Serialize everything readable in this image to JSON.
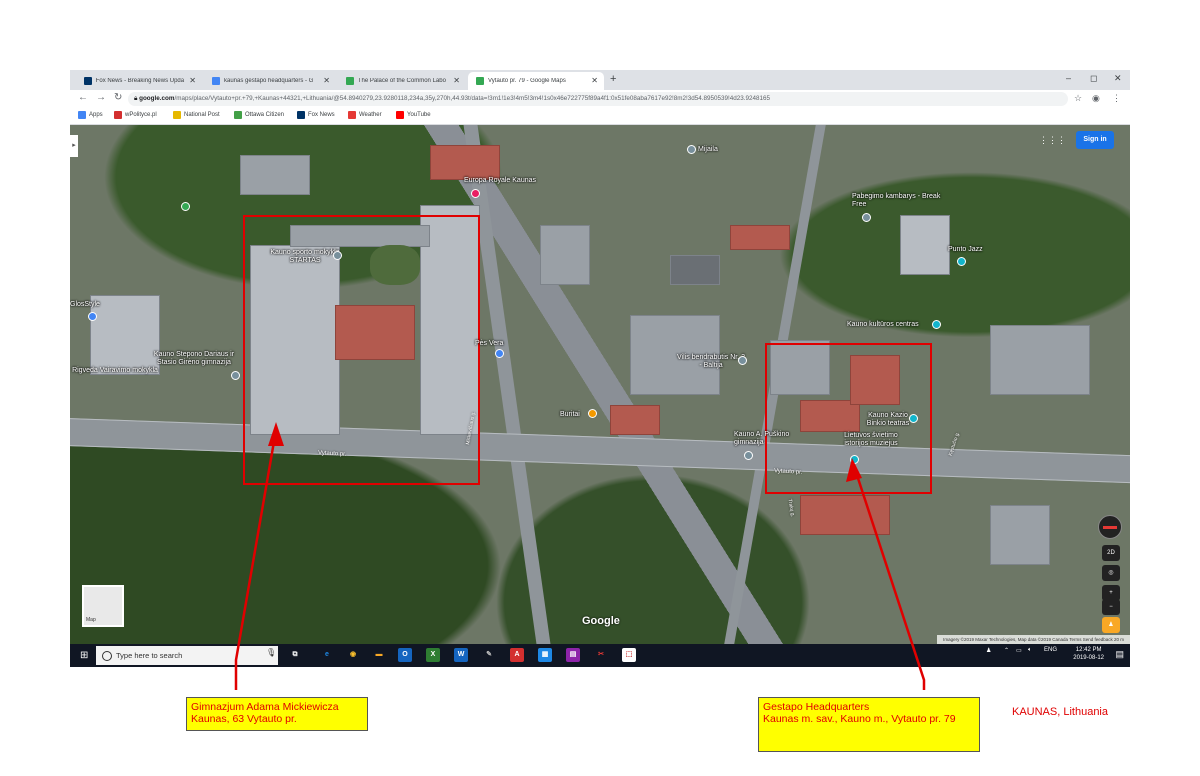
{
  "browser": {
    "tabs": [
      {
        "title": "Fox News - Breaking News Upda",
        "favicon_color": "#003366",
        "active": false
      },
      {
        "title": "kaunas gestapo headquarters - G",
        "favicon_color": "#4285f4",
        "active": false
      },
      {
        "title": "The Palace of the Common Labo",
        "favicon_color": "#34a853",
        "active": false
      },
      {
        "title": "Vytauto pr. 79 - Google Maps",
        "favicon_color": "#34a853",
        "active": true
      }
    ],
    "new_tab": "+",
    "window_controls": {
      "minimize": "–",
      "maximize": "◻",
      "close": "✕"
    },
    "url_host": "google.com",
    "url_path": "/maps/place/Vytauto+pr.+79,+Kaunas+44321,+Lithuania/@54.8940279,23.9280118,234a,35y,270h,44.93t/data=!3m1!1e3!4m5!3m4!1s0x46e722775f89a4f1:0x51fe08aba7617e92!8m2!3d54.8950539!4d23.9248165",
    "bookmarks": [
      {
        "label": "Apps",
        "color": "#4285f4"
      },
      {
        "label": "wPolityce.pl",
        "color": "#d32f2f"
      },
      {
        "label": "National Post",
        "color": "#e6b800"
      },
      {
        "label": "Ottawa Citizen",
        "color": "#43a047"
      },
      {
        "label": "Fox News",
        "color": "#003366"
      },
      {
        "label": "Weather",
        "color": "#e53935"
      },
      {
        "label": "YouTube",
        "color": "#ff0000"
      }
    ]
  },
  "map": {
    "sign_in": "Sign in",
    "places": [
      "Mijaila",
      "Europa Royale Kaunas",
      "Pabegimo kambarys - Break Free",
      "Punto Jazz",
      "Kauno sporto mokykla STARTAS",
      "GlosStyle",
      "Kauno kultūros centras",
      "Pės Vera",
      "Vilis bendrabutis Nr. 2 - Baltija",
      "Kauno Stepono Dariaus ir Stasio Girėno gimnazija",
      "Rigveda Vairavimo mokykla",
      "Buritai",
      "Kauno Kazio Binkio teatras",
      "Kauno A. Puškino gimnazija",
      "Lietuvos švietimo istorijos muziejus"
    ],
    "streets": [
      "Vytauto pr.",
      "Vytauto pr.",
      "Mickevičiaus g.",
      "Trakų g.",
      "Kęstučio g."
    ],
    "controls": {
      "tilt": "2D",
      "zoom_in": "+",
      "zoom_out": "−"
    },
    "minimap_label": "Map",
    "watermark": "Google",
    "attribution": "Imagery ©2019 Maxar Technologies, Map data ©2019   Canada   Terms   Send feedback   20 m"
  },
  "taskbar": {
    "search_placeholder": "Type here to search",
    "apps": [
      {
        "glyph": "e",
        "color": "#1e88e5"
      },
      {
        "glyph": "◉",
        "color": "#fbc02d"
      },
      {
        "glyph": "▬",
        "color": "#f9a825"
      },
      {
        "glyph": "O",
        "color": "#1565c0"
      },
      {
        "glyph": "X",
        "color": "#2e7d32"
      },
      {
        "glyph": "W",
        "color": "#1565c0"
      },
      {
        "glyph": "✎",
        "color": "#9e9e9e"
      },
      {
        "glyph": "A",
        "color": "#d32f2f"
      },
      {
        "glyph": "▦",
        "color": "#1e88e5"
      },
      {
        "glyph": "▤",
        "color": "#8e24aa"
      },
      {
        "glyph": "✂",
        "color": "#e53935"
      },
      {
        "glyph": "⬚",
        "color": "#c62828"
      }
    ],
    "language": "ENG",
    "time": "12:42 PM",
    "date": "2019-08-12",
    "notifications": "6"
  },
  "annotations": {
    "school": [
      "Gimnazjum Adama Mickiewicza",
      "Kaunas, 63 Vytauto pr."
    ],
    "gestapo": [
      "Gestapo Headquarters",
      "Kaunas m. sav., Kauno m., Vytauto pr. 79"
    ],
    "caption": "KAUNAS, Lithuania",
    "accent_color": "#e00000",
    "label_bg": "#ffff00"
  }
}
